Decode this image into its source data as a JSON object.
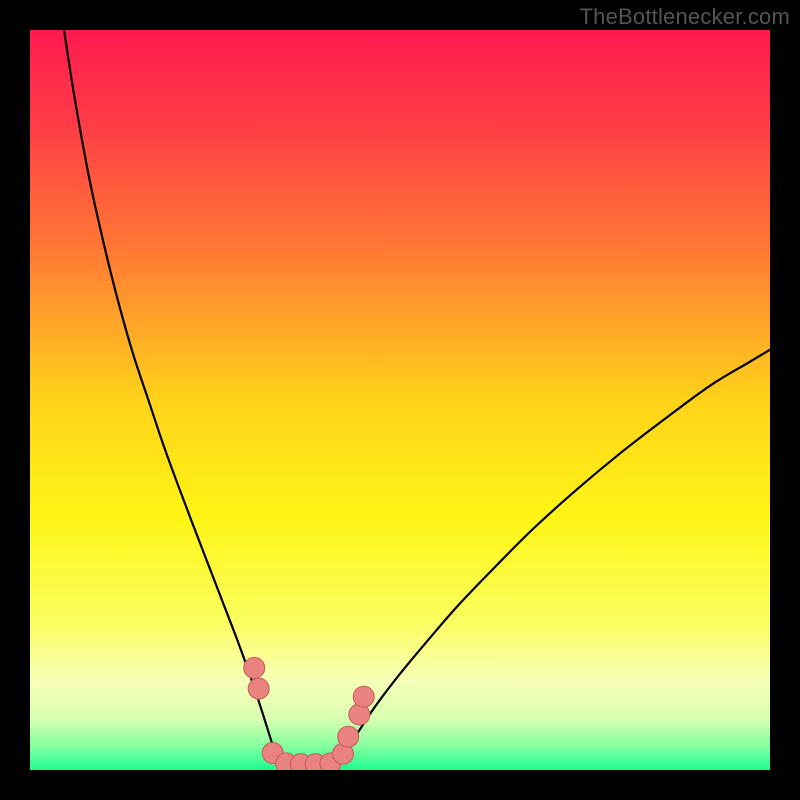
{
  "watermark": "TheBottlenecker.com",
  "chart_data": {
    "type": "line",
    "title": "",
    "xlabel": "",
    "ylabel": "",
    "xlim": [
      0,
      100
    ],
    "ylim": [
      0,
      100
    ],
    "background_gradient": {
      "stops": [
        {
          "offset": 0.0,
          "color": "#ff1a4e"
        },
        {
          "offset": 0.12,
          "color": "#ff3a47"
        },
        {
          "offset": 0.3,
          "color": "#ff7a34"
        },
        {
          "offset": 0.5,
          "color": "#ffd31a"
        },
        {
          "offset": 0.66,
          "color": "#fff516"
        },
        {
          "offset": 0.8,
          "color": "#fbff60"
        },
        {
          "offset": 0.88,
          "color": "#f7ffb8"
        },
        {
          "offset": 0.93,
          "color": "#d9ffb0"
        },
        {
          "offset": 0.97,
          "color": "#7fff9e"
        },
        {
          "offset": 1.0,
          "color": "#1dfc92"
        }
      ]
    },
    "series": [
      {
        "name": "left-curve",
        "x": [
          4.6,
          6,
          8,
          10,
          12,
          14,
          16,
          18,
          20,
          22,
          24,
          26,
          28,
          29.8,
          31.2,
          32.4,
          33.2,
          33.8
        ],
        "y": [
          100,
          91,
          80,
          71,
          63,
          56,
          50,
          44,
          38.5,
          33.2,
          28,
          22.8,
          17.6,
          12.6,
          8.4,
          4.6,
          2,
          0.2
        ]
      },
      {
        "name": "right-curve",
        "x": [
          41.4,
          42.6,
          44.4,
          46.8,
          50,
          54,
          58,
          63,
          68,
          74,
          80,
          86,
          92,
          97,
          100
        ],
        "y": [
          0.3,
          2.2,
          5.2,
          8.8,
          13,
          17.8,
          22.4,
          27.6,
          32.6,
          38,
          43,
          47.6,
          52,
          55,
          56.8
        ]
      }
    ],
    "markers": [
      {
        "x": 30.3,
        "y": 13.8
      },
      {
        "x": 30.9,
        "y": 11.0
      },
      {
        "x": 32.8,
        "y": 2.3
      },
      {
        "x": 34.6,
        "y": 0.9
      },
      {
        "x": 36.6,
        "y": 0.8
      },
      {
        "x": 38.6,
        "y": 0.8
      },
      {
        "x": 40.6,
        "y": 0.9
      },
      {
        "x": 42.3,
        "y": 2.2
      },
      {
        "x": 43.0,
        "y": 4.5
      },
      {
        "x": 44.5,
        "y": 7.5
      },
      {
        "x": 45.1,
        "y": 9.9
      }
    ],
    "marker_style": {
      "fill": "#e9837f",
      "stroke": "#c65a56",
      "r": 10.5
    },
    "curve_style": {
      "stroke": "#000000",
      "width": 2.2
    }
  }
}
